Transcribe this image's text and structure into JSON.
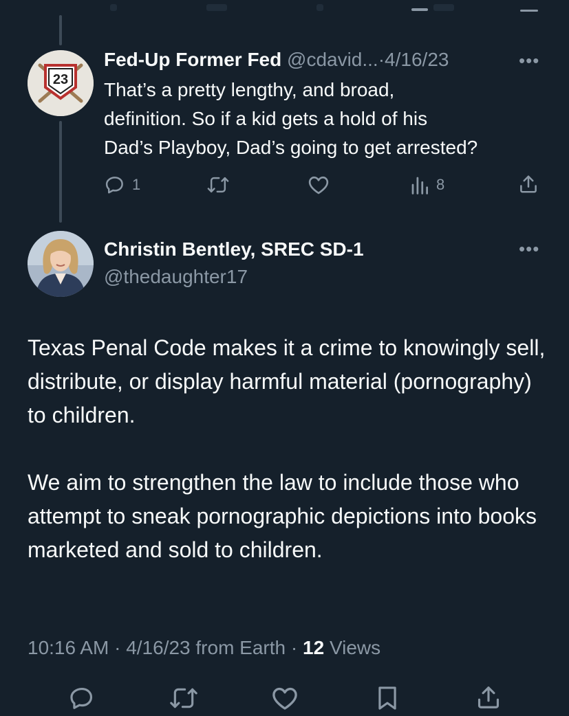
{
  "reply": {
    "display_name": "Fed-Up Former Fed",
    "handle": "@cdavid...",
    "separator": "·",
    "date": "4/16/23",
    "avatar_badge": "23",
    "text_lines": [
      "That’s a pretty lengthy, and broad,",
      "definition. So if a kid gets a hold of his",
      "Dad’s Playboy, Dad’s going to get arrested?"
    ],
    "replies_count": "1",
    "views_count": "8",
    "more_label": "•••"
  },
  "main_tweet": {
    "display_name": "Christin Bentley, SREC SD-1",
    "handle": "@thedaughter17",
    "more_label": "•••",
    "paragraphs": [
      "Texas Penal Code makes it a crime to knowingly sell, distribute, or display harmful material (pornography) to children.",
      "We aim to strengthen the law to include those who attempt to sneak pornographic depictions into books marketed and sold to children."
    ],
    "meta": {
      "time": "10:16 AM",
      "dot": "·",
      "date": "4/16/23",
      "source": "from Earth",
      "views_count": "12",
      "views_label": "Views"
    }
  },
  "icons": {
    "reply": "reply-icon",
    "retweet": "retweet-icon",
    "like": "heart-icon",
    "views": "views-chart-icon",
    "share": "share-icon",
    "bookmark": "bookmark-icon",
    "more": "more-icon"
  },
  "colors": {
    "background": "#15202b",
    "text_primary": "#f7f9f9",
    "text_secondary": "#8b98a5",
    "thread_line": "#3d4a57"
  }
}
